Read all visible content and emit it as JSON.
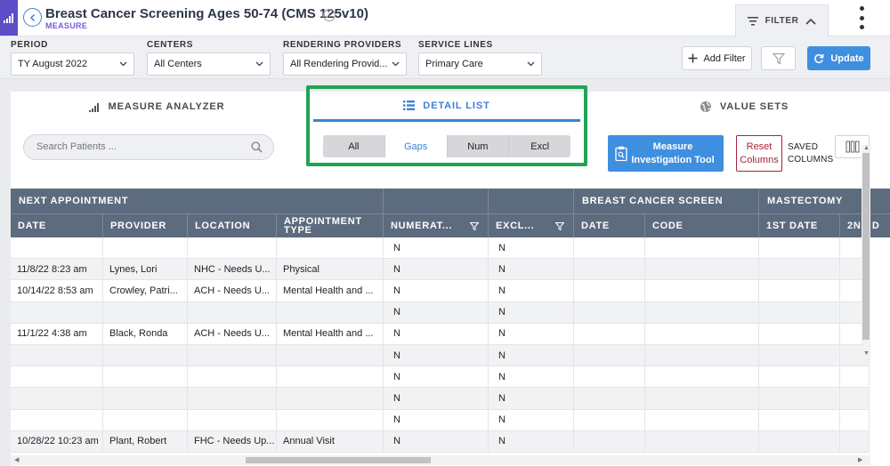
{
  "header": {
    "title": "Breast Cancer Screening Ages 50-74 (CMS 125v10)",
    "subtitle": "MEASURE",
    "filter_label": "FILTER"
  },
  "filters": {
    "period": {
      "label": "PERIOD",
      "value": "TY August 2022"
    },
    "centers": {
      "label": "CENTERS",
      "value": "All Centers"
    },
    "providers": {
      "label": "RENDERING PROVIDERS",
      "value": "All Rendering Provid..."
    },
    "service": {
      "label": "SERVICE LINES",
      "value": "Primary Care"
    },
    "add_filter": "Add Filter",
    "update": "Update"
  },
  "tabs": [
    {
      "label": "MEASURE ANALYZER"
    },
    {
      "label": "DETAIL LIST"
    },
    {
      "label": "VALUE SETS"
    }
  ],
  "search": {
    "placeholder": "Search Patients ..."
  },
  "segments": [
    "All",
    "Gaps",
    "Num",
    "Excl"
  ],
  "actions": {
    "mit_line1": "Measure",
    "mit_line2": "Investigation Tool",
    "reset_line1": "Reset",
    "reset_line2": "Columns",
    "saved_line1": "SAVED",
    "saved_line2": "COLUMNS"
  },
  "table": {
    "groups": [
      "NEXT APPOINTMENT",
      "",
      "",
      "BREAST CANCER SCREEN",
      "MASTECTOMY"
    ],
    "columns": [
      "DATE",
      "PROVIDER",
      "LOCATION",
      "APPOINTMENT TYPE",
      "NUMERAT...",
      "EXCL...",
      "DATE",
      "CODE",
      "1ST DATE",
      "2ND D"
    ],
    "rows": [
      [
        "",
        "",
        "",
        "",
        "N",
        "N"
      ],
      [
        "11/8/22 8:23 am",
        "Lynes, Lori",
        "NHC - Needs U...",
        "Physical",
        "N",
        "N"
      ],
      [
        "10/14/22 8:53 am",
        "Crowley, Patri...",
        "ACH - Needs U...",
        "Mental Health and ...",
        "N",
        "N"
      ],
      [
        "",
        "",
        "",
        "",
        "N",
        "N"
      ],
      [
        "11/1/22 4:38 am",
        "Black, Ronda",
        "ACH - Needs U...",
        "Mental Health and ...",
        "N",
        "N"
      ],
      [
        "",
        "",
        "",
        "",
        "N",
        "N"
      ],
      [
        "",
        "",
        "",
        "",
        "N",
        "N"
      ],
      [
        "",
        "",
        "",
        "",
        "N",
        "N"
      ],
      [
        "",
        "",
        "",
        "",
        "N",
        "N"
      ],
      [
        "10/28/22 10:23 am",
        "Plant, Robert",
        "FHC - Needs Up...",
        "Annual Visit",
        "N",
        "N"
      ]
    ]
  }
}
